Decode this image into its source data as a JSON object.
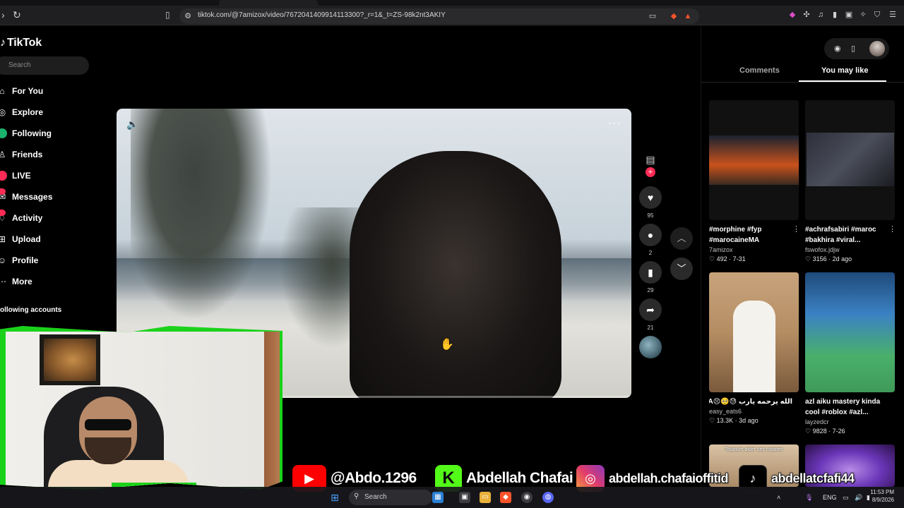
{
  "browser": {
    "url": "tiktok.com/@7amizox/video/7672041409914113300?_r=1&_t=ZS-98k2nt3AKIY"
  },
  "sidebar": {
    "logo": "TikTok",
    "search_placeholder": "Search",
    "items": [
      {
        "label": "For You",
        "icon": "home-icon"
      },
      {
        "label": "Explore",
        "icon": "compass-icon"
      },
      {
        "label": "Following",
        "icon": "users-icon"
      },
      {
        "label": "Friends",
        "icon": "friends-icon"
      },
      {
        "label": "LIVE",
        "icon": "live-icon"
      },
      {
        "label": "Messages",
        "icon": "message-icon"
      },
      {
        "label": "Activity",
        "icon": "bell-icon"
      },
      {
        "label": "Upload",
        "icon": "upload-icon"
      },
      {
        "label": "Profile",
        "icon": "profile-icon"
      },
      {
        "label": "More",
        "icon": "more-icon"
      }
    ],
    "following_title": "ollowing accounts"
  },
  "video": {
    "progress": 0.05
  },
  "actions": {
    "likes": "95",
    "comments": "2",
    "saves": "29",
    "shares": "21"
  },
  "right_panel": {
    "tabs": [
      "Comments",
      "You may like"
    ],
    "active_tab": "You may like",
    "cards": [
      {
        "caption1": "#morphine #fyp",
        "caption2": "#marocaineMA",
        "author": "7amizox",
        "likes": "492",
        "date": "7-31"
      },
      {
        "caption1": "#achrafsabiri #maroc",
        "caption2": "#bakhira #viral...",
        "author": "fswofox.jdjw",
        "likes": "3156",
        "date": "2d ago"
      },
      {
        "caption1": "الله يرحمه يارب 😓🥺😣MA",
        "caption2": "",
        "author": "easy_eats6",
        "likes": "13.3K",
        "date": "3d ago"
      },
      {
        "caption1": "azl aiku mastery kinda",
        "caption2": "cool #roblox #azl...",
        "author": "layzedcr",
        "likes": "9828",
        "date": "7-26"
      }
    ],
    "thumb_text": "Toujours aider ses copines"
  },
  "banner": {
    "youtube": "@Abdo.1296",
    "kick": "Abdellah Chafai",
    "instagram": "abdellah.chafaioffitid",
    "tiktok": "abdellatcfafi44"
  },
  "taskbar": {
    "search": "Search",
    "lang": "ENG",
    "time": "11:53 PM",
    "date": "8/9/2026"
  },
  "colors": {
    "accent": "#fe2c55",
    "cam_frame": "#1bd21b",
    "youtube": "#ff0000",
    "kick": "#53fc18"
  }
}
